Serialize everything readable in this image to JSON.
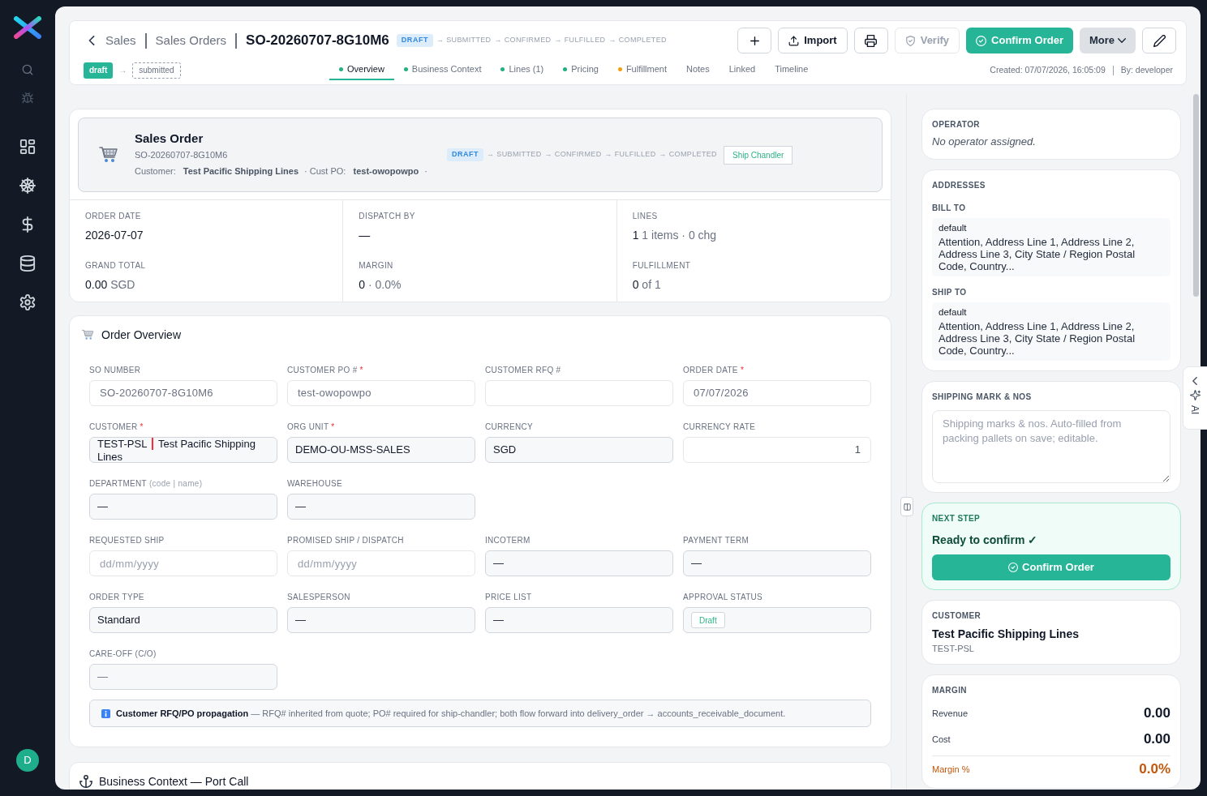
{
  "sidebar": {
    "avatar": "D"
  },
  "header": {
    "breadcrumbs": [
      {
        "label": "Sales"
      },
      {
        "label": "Sales Orders"
      }
    ],
    "title": "SO-20260707-8G10M6",
    "status_flow": {
      "separator": "→",
      "steps": [
        {
          "label": "DRAFT",
          "selected": true
        },
        {
          "label": "SUBMITTED",
          "selected": false
        },
        {
          "label": "CONFIRMED",
          "selected": false
        },
        {
          "label": "FULFILLED",
          "selected": false
        },
        {
          "label": "COMPLETED",
          "selected": false
        }
      ]
    },
    "actions": [
      {
        "kind": "add",
        "disabled": false
      },
      {
        "kind": "import",
        "label": "Import",
        "disabled": false
      },
      {
        "kind": "print",
        "disabled": false
      },
      {
        "kind": "verify",
        "label": "Verify",
        "disabled": true
      },
      {
        "kind": "confirm",
        "label": "Confirm Order",
        "disabled": false
      },
      {
        "kind": "more",
        "label": "More",
        "disabled": false
      },
      {
        "kind": "edit",
        "disabled": false
      }
    ],
    "stages": {
      "separator": "→",
      "items": [
        {
          "label": "draft",
          "selected": true
        },
        {
          "label": "submitted",
          "selected": false
        }
      ]
    },
    "tabs": [
      {
        "label": "Overview",
        "selected": true,
        "color": "#22b07d"
      },
      {
        "label": "Business Context",
        "selected": false,
        "color": "#22b07d"
      },
      {
        "label": "Lines (1)",
        "selected": false,
        "color": "#22b07d"
      },
      {
        "label": "Pricing",
        "selected": false,
        "color": "#22b07d"
      },
      {
        "label": "Fulfillment",
        "selected": false,
        "color": "#f59e0b"
      },
      {
        "label": "Notes",
        "selected": false
      },
      {
        "label": "Linked",
        "selected": false
      },
      {
        "label": "Timeline",
        "selected": false
      }
    ],
    "meta": {
      "created": "Created: 07/07/2026, 16:05:09",
      "by": "By: developer"
    }
  },
  "summary": {
    "title": "Sales Order",
    "number": "SO-20260707-8G10M6",
    "details": "Customer: **Test Pacific Shipping Lines** · Cust PO: **test-owopowpo** ·",
    "status_flow": {
      "separator": "→",
      "steps": [
        {
          "label": "DRAFT",
          "selected": true
        },
        {
          "label": "SUBMITTED",
          "selected": false
        },
        {
          "label": "CONFIRMED",
          "selected": false
        },
        {
          "label": "FULFILLED",
          "selected": false
        },
        {
          "label": "COMPLETED",
          "selected": false
        }
      ]
    },
    "tag": "Ship Chandler",
    "stats": [
      {
        "label": "ORDER DATE",
        "value": "2026-07-07"
      },
      {
        "label": "DISPATCH BY",
        "value": "—"
      },
      {
        "label": "LINES",
        "value": "1",
        "suffix": "1 items · 0 chg"
      },
      {
        "label": "GRAND TOTAL",
        "value": "0.00",
        "suffix": "SGD"
      },
      {
        "label": "MARGIN",
        "value": "0",
        "suffix": "· 0.0%"
      },
      {
        "label": "FULFILLMENT",
        "value": "0",
        "suffix": "of 1"
      }
    ]
  },
  "order_overview": {
    "title": "Order Overview",
    "field_rows": [
      [
        {
          "label": "SO NUMBER",
          "kind": "readonly",
          "value": "SO-20260707-8G10M6"
        },
        {
          "label": "CUSTOMER PO #",
          "mark": "*",
          "kind": "readonly",
          "value": "test-owopowpo"
        },
        {
          "label": "CUSTOMER RFQ #",
          "kind": "text"
        },
        {
          "label": "ORDER DATE",
          "mark": "*",
          "kind": "readonly",
          "value": "07/07/2026"
        }
      ],
      [
        {
          "label": "CUSTOMER",
          "mark": "*",
          "kind": "lookup",
          "code": "TEST-PSL",
          "value": "Test Pacific Shipping Lines"
        },
        {
          "label": "ORG UNIT",
          "mark": "*",
          "kind": "select",
          "value": "DEMO-OU-MSS-SALES"
        },
        {
          "label": "CURRENCY",
          "kind": "select",
          "value": "SGD"
        },
        {
          "label": "CURRENCY RATE",
          "kind": "number",
          "value": "1"
        }
      ],
      [
        {
          "label": "DEPARTMENT",
          "hint": "(code | name)",
          "kind": "select",
          "value": "—"
        },
        {
          "label": "WAREHOUSE",
          "kind": "select",
          "value": "—"
        }
      ],
      [
        {
          "label": "REQUESTED SHIP",
          "kind": "date",
          "placeholder": "dd/mm/yyyy"
        },
        {
          "label": "PROMISED SHIP / DISPATCH",
          "kind": "date",
          "placeholder": "dd/mm/yyyy"
        },
        {
          "label": "INCOTERM",
          "kind": "select",
          "value": "—"
        },
        {
          "label": "PAYMENT TERM",
          "kind": "select",
          "value": "—"
        }
      ],
      [
        {
          "label": "ORDER TYPE",
          "kind": "select",
          "value": "Standard"
        },
        {
          "label": "SALESPERSON",
          "kind": "select",
          "value": "—"
        },
        {
          "label": "PRICE LIST",
          "kind": "select",
          "value": "—"
        },
        {
          "label": "APPROVAL STATUS",
          "kind": "badge",
          "value": "Draft"
        }
      ],
      [
        {
          "label": "CARE-OFF (C/O)",
          "kind": "locked",
          "value": "—"
        }
      ]
    ],
    "note": "**Customer RFQ/PO propagation** — RFQ# inherited from quote; PO# required for ship-chandler; both flow forward into delivery_order → accounts_receivable_document."
  },
  "business_context": {
    "title": "Business Context — Port Call"
  },
  "operator": {
    "label": "OPERATOR",
    "text": "No operator assigned."
  },
  "addresses": {
    "label": "ADDRESSES",
    "blocks": [
      {
        "label": "BILL TO",
        "name": "default",
        "text": "Attention, Address Line 1, Address Line 2, Address Line 3, City State / Region Postal Code, Country..."
      },
      {
        "label": "SHIP TO",
        "name": "default",
        "text": "Attention, Address Line 1, Address Line 2, Address Line 3, City State / Region Postal Code, Country..."
      }
    ]
  },
  "shipping_mark": {
    "label": "SHIPPING MARK & NOS",
    "placeholder": "Shipping marks & nos. Auto-filled from packing pallets on save; editable."
  },
  "next_step": {
    "label": "NEXT STEP",
    "text": "Ready to confirm ✓",
    "button": "Confirm Order"
  },
  "customer": {
    "label": "CUSTOMER",
    "name": "Test Pacific Shipping Lines",
    "code": "TEST-PSL"
  },
  "margin": {
    "label": "MARGIN",
    "rows": [
      {
        "label": "Revenue",
        "value": "0.00",
        "kind": "plain"
      },
      {
        "label": "Cost",
        "value": "0.00",
        "kind": "plain"
      },
      {
        "label": "Margin %",
        "value": "0.0%",
        "kind": "total"
      }
    ]
  },
  "ai_tab": {
    "label": "AI"
  }
}
